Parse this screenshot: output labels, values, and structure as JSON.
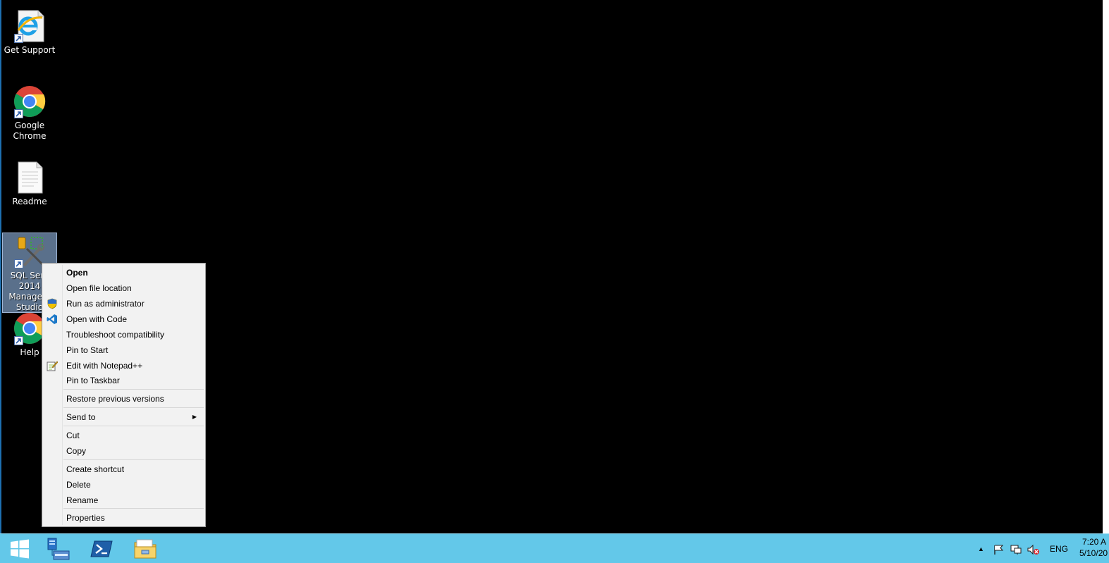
{
  "desktop": {
    "icons": [
      {
        "label": "Get Support",
        "icon": "internet-explorer-icon"
      },
      {
        "label": "Google Chrome",
        "icon": "chrome-icon"
      },
      {
        "label": "Readme",
        "icon": "text-document-icon"
      },
      {
        "label": "SQL Server 2014 Management Studio",
        "label_visible_lines": [
          "SQL Serv",
          "2014",
          "Managem",
          "Studio"
        ],
        "icon": "sql-server-management-studio-icon",
        "selected": true
      },
      {
        "label": "Help",
        "icon": "chrome-icon"
      }
    ]
  },
  "context_menu": {
    "items": [
      {
        "label": "Open",
        "bold": true,
        "icon": ""
      },
      {
        "label": "Open file location",
        "icon": ""
      },
      {
        "label": "Run as administrator",
        "icon": "uac-shield-icon"
      },
      {
        "label": "Open with Code",
        "icon": "vscode-icon"
      },
      {
        "label": "Troubleshoot compatibility",
        "icon": ""
      },
      {
        "label": "Pin to Start",
        "icon": ""
      },
      {
        "label": "Edit with Notepad++",
        "icon": "notepad-plus-plus-icon"
      },
      {
        "label": "Pin to Taskbar",
        "icon": ""
      },
      {
        "label": "Restore previous versions",
        "icon": ""
      },
      {
        "label": "Send to",
        "icon": "",
        "submenu": true
      },
      {
        "label": "Cut",
        "icon": ""
      },
      {
        "label": "Copy",
        "icon": ""
      },
      {
        "label": "Create shortcut",
        "icon": ""
      },
      {
        "label": "Delete",
        "icon": ""
      },
      {
        "label": "Rename",
        "icon": ""
      },
      {
        "label": "Properties",
        "icon": ""
      }
    ]
  },
  "taskbar": {
    "pinned": [
      {
        "name": "start-button",
        "icon": "windows-logo-icon"
      },
      {
        "name": "server-manager",
        "icon": "server-manager-icon"
      },
      {
        "name": "powershell",
        "icon": "powershell-icon"
      },
      {
        "name": "file-explorer",
        "icon": "folder-icon"
      }
    ],
    "tray": {
      "language": "ENG",
      "time": "7:20 A",
      "date": "5/10/20",
      "icons": [
        "show-hidden-icons-arrow",
        "action-center-flag-icon",
        "network-icon",
        "speaker-muted-icon"
      ]
    },
    "color": "#63c8e9"
  }
}
